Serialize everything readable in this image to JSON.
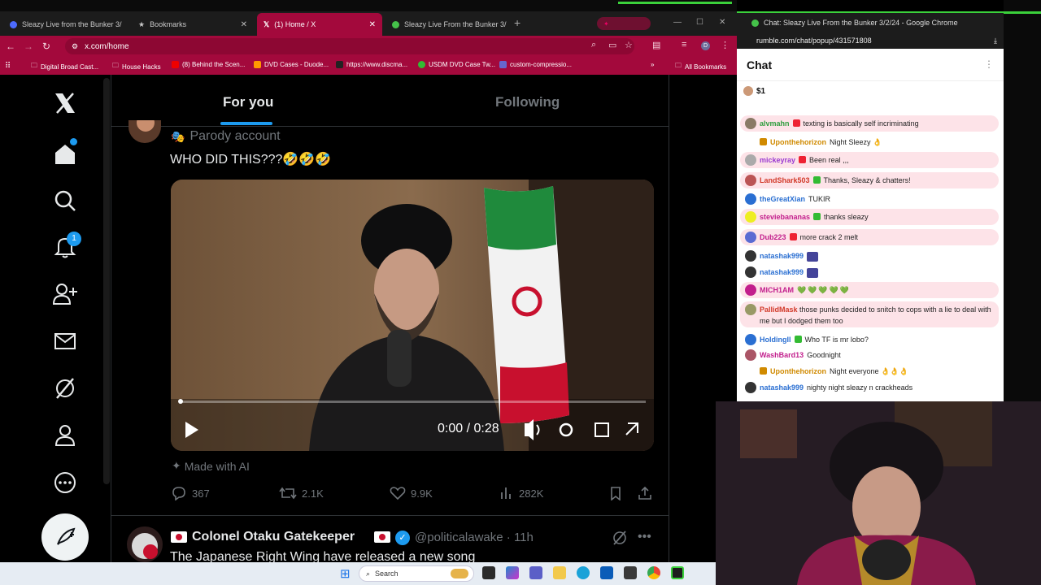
{
  "browser": {
    "tabs": [
      {
        "title": "Sleazy Live from the Bunker 3/",
        "color": "#4d6bff"
      },
      {
        "title": "Bookmarks",
        "color": "#ffffff"
      },
      {
        "title": "(1) Home / X",
        "color": "#ffffff"
      },
      {
        "title": "Sleazy Live From the Bunker 3/",
        "color": "#45c24a"
      }
    ],
    "url": "x.com/home",
    "profile_initial": "D",
    "bookmarks": [
      "Digital Broad Cast...",
      "House Hacks",
      "(8) Behind the Scen...",
      "DVD Cases - Duode...",
      "https://www.discma...",
      "USDM DVD Case Tw...",
      "custom-compressio..."
    ],
    "all_bookmarks": "All Bookmarks",
    "accent": "#a3093c"
  },
  "x": {
    "tabs": {
      "for_you": "For you",
      "following": "Following"
    },
    "notifications_count": "1",
    "tweet1": {
      "parody": "Parody account",
      "text": "WHO DID THIS???🤣🤣🤣",
      "video_time": "0:00 / 0:28",
      "made_with_ai": "Made with AI",
      "replies": "367",
      "reposts": "2.1K",
      "likes": "9.9K",
      "views": "282K"
    },
    "tweet2": {
      "name": "Colonel Otaku Gatekeeper",
      "handle": "@politicalawake · 11h",
      "text": "The Japanese Right Wing have released a new song"
    }
  },
  "taskbar": {
    "search_placeholder": "Search"
  },
  "chat": {
    "window_title": "Chat: Sleazy Live From the Bunker 3/2/24 - Google Chrome",
    "url": "rumble.com/chat/popup/431571808",
    "title": "Chat",
    "rant": "$1",
    "messages": [
      {
        "user": "alvmahn",
        "text": "texting is basically self incriminating",
        "color": "#2e9e3e",
        "hl": true
      },
      {
        "user": "Uponthehorizon",
        "text": "Night Sleezy 👌",
        "color": "#d08a00",
        "hl": false
      },
      {
        "user": "mickeyray",
        "text": "Been real ,,,",
        "color": "#9b3bd1",
        "hl": true
      },
      {
        "user": "LandShark503",
        "text": "Thanks, Sleazy & chatters!",
        "color": "#d23a2a",
        "hl": true
      },
      {
        "user": "theGreatXian",
        "text": "TUKIR",
        "color": "#2a6fd2",
        "hl": false
      },
      {
        "user": "steviebananas",
        "text": "thanks sleazy",
        "color": "#c21e8c",
        "hl": true
      },
      {
        "user": "Dub223",
        "text": "more crack 2 melt",
        "color": "#2a6fd2",
        "hl": true
      },
      {
        "user": "natashak999",
        "text": "",
        "color": "#2a6fd2",
        "hl": false
      },
      {
        "user": "natashak999",
        "text": "",
        "color": "#2a6fd2",
        "hl": false
      },
      {
        "user": "MICH1AM",
        "text": "",
        "color": "#c21e8c",
        "hl": true
      },
      {
        "user": "PallidMask",
        "text": "those punks decided to snitch to cops with a lie to deal with me but I dodged them too",
        "color": "#d23a2a",
        "hl": true
      },
      {
        "user": "HoldingIl",
        "text": "Who TF is mr lobo?",
        "color": "#2a6fd2",
        "hl": false
      },
      {
        "user": "WashBard13",
        "text": "Goodnight",
        "color": "#c21e8c",
        "hl": false
      },
      {
        "user": "Uponthehorizon",
        "text": "Night everyone 👌👌👌",
        "color": "#d08a00",
        "hl": false
      },
      {
        "user": "natashak999",
        "text": "nighty night sleazy n crackheads",
        "color": "#2a6fd2",
        "hl": false
      }
    ]
  }
}
